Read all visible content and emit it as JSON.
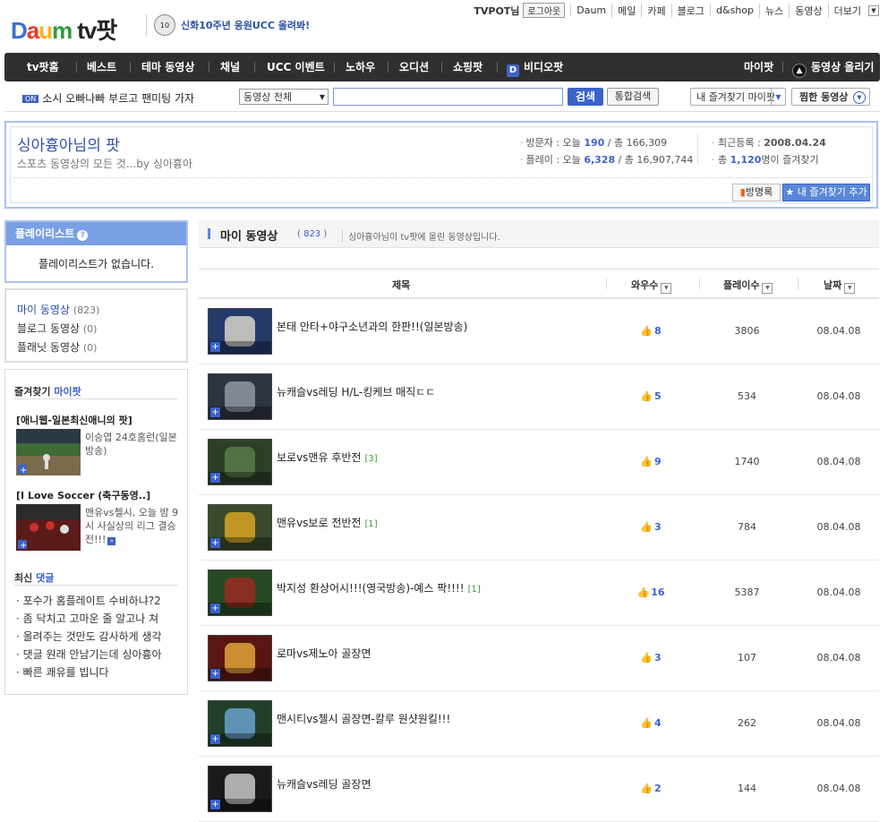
{
  "brand": {
    "logo_daum": "Daum",
    "logo_tv": "tv팟",
    "promo_badge": "10",
    "promo_text": "신화10주년 응원UCC 올려봐!"
  },
  "util": {
    "user": "TVPOT님",
    "logout": "로그아웃",
    "links": [
      "Daum",
      "메일",
      "카페",
      "블로그",
      "d&shop",
      "뉴스",
      "동영상",
      "더보기"
    ]
  },
  "nav": {
    "items": [
      "tv팟홈",
      "베스트",
      "테마 동영상",
      "채널",
      "UCC 이벤트",
      "노하우",
      "오디션",
      "쇼핑팟",
      "비디오팟"
    ],
    "right": [
      "마이팟",
      "동영상 올리기"
    ]
  },
  "search": {
    "ticker_badge": "ON",
    "ticker": "소시 오빠나빠 부르고 팬미팅 가자",
    "category": "동영상 전체",
    "query": "",
    "search_btn": "검색",
    "all_btn": "통합검색",
    "fav_btn": "내 즐겨찾기 마이팟",
    "jjim_btn": "찜한 동영상"
  },
  "profile": {
    "title": "싱아흉아님의 팟",
    "subtitle": "스포츠 동영상의 모든 것...by 싱아흉아",
    "visitor_label": "방문자 : 오늘",
    "visitor_today": "190",
    "visitor_total": "/ 총 166,309",
    "play_label": "플레이 : 오늘",
    "play_today": "6,328",
    "play_total": "/ 총 16,907,744",
    "recent_label": "최근등록 :",
    "recent_date": "2008.04.24",
    "fav_prefix": "총",
    "fav_count": "1,120",
    "fav_suffix": "명이 즐겨찾기",
    "guestbook_btn": "방명록",
    "addfav_btn": "★ 내 즐겨찾기 추가"
  },
  "sidebar": {
    "playlist_title": "플레이리스트",
    "playlist_empty": "플레이리스트가 없습니다.",
    "myvids": [
      {
        "label": "마이 동영상",
        "count": "(823)"
      },
      {
        "label": "블로그 동영상",
        "count": "(0)"
      },
      {
        "label": "플래닛 동영상",
        "count": "(0)"
      }
    ],
    "fav_heading": "즐겨찾기",
    "fav_heading_hl": "마이팟",
    "favs": [
      {
        "title": "[애니웹-일본최신애니의 팟]",
        "desc": "이승엽 24호홈런(일본방송)"
      },
      {
        "title": "[I Love Soccer (축구동영..]",
        "desc": "맨유vs첼시, 오늘 밤 9시 사실상의 리그 결승전!!!"
      }
    ],
    "recent_heading": "최신",
    "recent_heading_hl": "댓글",
    "comments": [
      "· 포수가 홈플레이트 수비하냐?2",
      "· 좀 닥치고 고마운 줄 알고나 쳐",
      "· 올려주는 것만도 감사하게 생각",
      "· 댓글 원래 안남기는데 싱아흉아",
      "· 빠른 쾌유를 빕니다"
    ]
  },
  "main": {
    "title": "마이 동영상",
    "count": "( 823 )",
    "desc": "싱아흉아님이 tv팟에 올린 동영상입니다.",
    "col_title": "제목",
    "col_wow": "와우수",
    "col_plays": "플레이수",
    "col_date": "날짜",
    "rows": [
      {
        "title": "본태 안타+야구소년과의 한판!!(일본방송)",
        "comments": "",
        "wow": "8",
        "plays": "3806",
        "date": "08.04.08",
        "c1": "#233a6b",
        "c2": "#d9d3c8"
      },
      {
        "title": "뉴캐슬vs레딩 H/L-킹케브 매직ㄷㄷ",
        "comments": "",
        "wow": "5",
        "plays": "534",
        "date": "08.04.08",
        "c1": "#2d3340",
        "c2": "#8f96a4"
      },
      {
        "title": "보로vs맨유 후반전",
        "comments": "[3]",
        "wow": "9",
        "plays": "1740",
        "date": "08.04.08",
        "c1": "#2d4027",
        "c2": "#5c7b4a"
      },
      {
        "title": "맨유vs보로 전반전",
        "comments": "[1]",
        "wow": "3",
        "plays": "784",
        "date": "08.04.08",
        "c1": "#3a4a2d",
        "c2": "#d8a525"
      },
      {
        "title": "박지성 환상어시!!!(영국방송)-예스 팍!!!!",
        "comments": "[1]",
        "wow": "16",
        "plays": "5387",
        "date": "08.04.08",
        "c1": "#254a25",
        "c2": "#9a2a23"
      },
      {
        "title": "로마vs제노아 골장면",
        "comments": "",
        "wow": "3",
        "plays": "107",
        "date": "08.04.08",
        "c1": "#5a1612",
        "c2": "#e0a33a"
      },
      {
        "title": "맨시티vs첼시 골장면-칼루 원샷원킬!!!",
        "comments": "",
        "wow": "4",
        "plays": "262",
        "date": "08.04.08",
        "c1": "#233f2a",
        "c2": "#6aa2cf"
      },
      {
        "title": "뉴캐슬vs레딩 골장면",
        "comments": "",
        "wow": "2",
        "plays": "144",
        "date": "08.04.08",
        "c1": "#1a1a1a",
        "c2": "#c8c8c8"
      }
    ]
  },
  "colors": {
    "accent": "#3a62c9",
    "nav_bg": "#2f2f2f",
    "panel_border": "#a9c2ee",
    "playlist_head": "#7aa0e4"
  }
}
